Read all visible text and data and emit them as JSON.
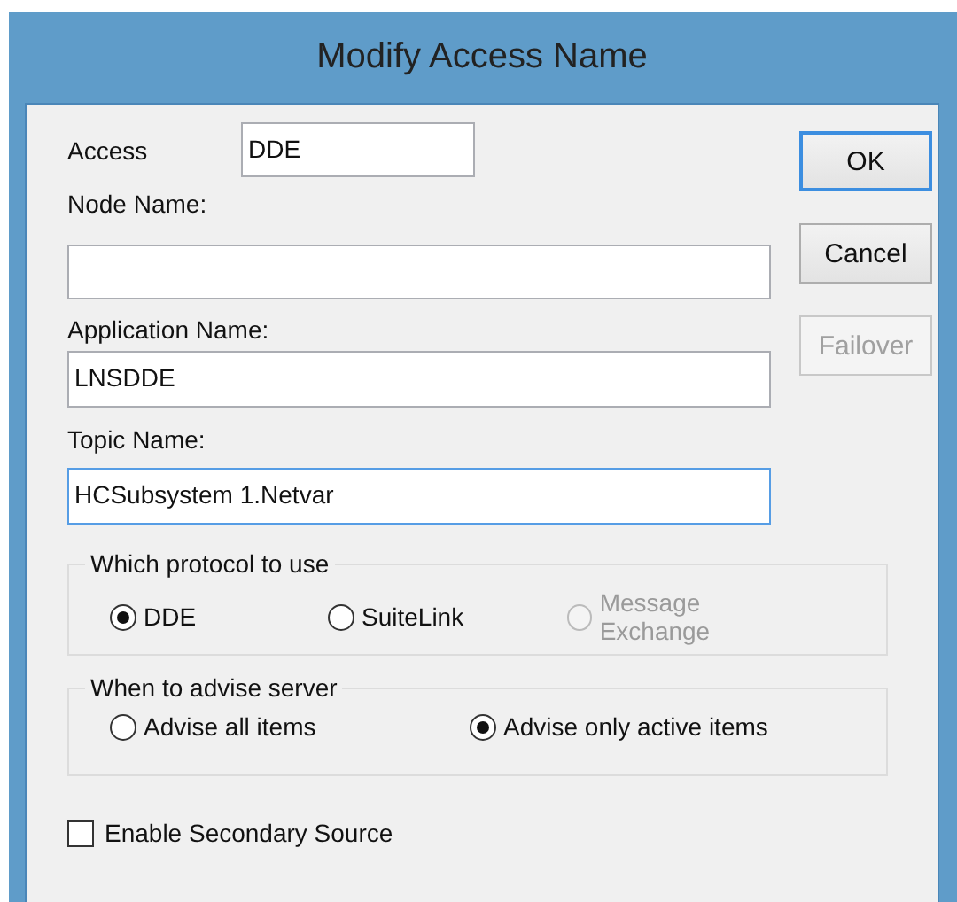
{
  "window": {
    "title": "Modify Access Name"
  },
  "fields": [
    {
      "kind": "inline",
      "label": "Access",
      "value": "DDE",
      "focused": false
    },
    {
      "kind": "stacked",
      "label": "Node Name:",
      "focused": false
    },
    {
      "kind": "stacked",
      "label": "Application Name:",
      "value": "LNSDDE",
      "focused": false
    },
    {
      "kind": "stacked",
      "label": "Topic Name:",
      "value": "HCSubsystem 1.Netvar",
      "focused": true
    }
  ],
  "buttons": [
    {
      "label": "OK",
      "default": true,
      "disabled": false
    },
    {
      "label": "Cancel",
      "default": false,
      "disabled": false
    },
    {
      "label": "Failover",
      "default": false,
      "disabled": true
    }
  ],
  "groups": [
    {
      "title": "Which protocol to use",
      "options": [
        {
          "label": "DDE",
          "selected": true,
          "disabled": false
        },
        {
          "label": "SuiteLink",
          "selected": false,
          "disabled": false
        },
        {
          "label": "Message Exchange",
          "selected": false,
          "disabled": true
        }
      ]
    },
    {
      "title": "When to advise server",
      "options": [
        {
          "label": "Advise all items",
          "selected": false,
          "disabled": false
        },
        {
          "label": "Advise only active items",
          "selected": true,
          "disabled": false
        }
      ]
    }
  ],
  "checkbox": {
    "label": "Enable Secondary Source",
    "checked": false
  }
}
